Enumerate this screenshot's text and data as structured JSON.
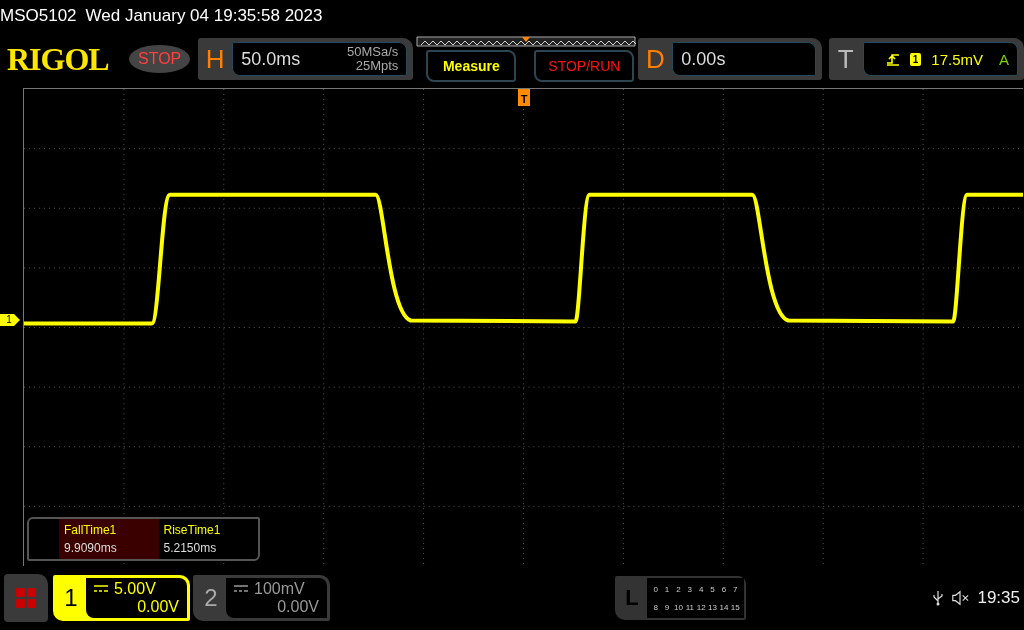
{
  "status_line": {
    "model": "MSO5102",
    "datetime": "Wed January 04 19:35:58 2023"
  },
  "brand": "RIGOL",
  "run_state": "STOP",
  "horizontal": {
    "label": "H",
    "timebase": "50.0ms",
    "sample_rate": "50MSa/s",
    "memory_depth": "25Mpts"
  },
  "buttons": [
    {
      "label": "Measure",
      "color": "#ffff00"
    },
    {
      "label": "STOP/RUN",
      "color": "#ff1010"
    }
  ],
  "delay": {
    "label": "D",
    "value": "0.00s"
  },
  "trigger": {
    "label": "T",
    "channel": "1",
    "level": "17.5mV",
    "mode": "A"
  },
  "markers": {
    "channel": "1",
    "trigger": "T"
  },
  "measurements": [
    {
      "name": "FallTime1",
      "value": "9.9090ms",
      "selected": true
    },
    {
      "name": "RiseTime1",
      "value": "5.2150ms",
      "selected": false
    }
  ],
  "channels": [
    {
      "number": "1",
      "scale": "5.00V",
      "offset": "0.00V",
      "selected": true
    },
    {
      "number": "2",
      "scale": "100mV",
      "offset": "0.00V",
      "selected": false
    }
  ],
  "logic": {
    "label": "L",
    "rows": [
      [
        "0",
        "1",
        "2",
        "3",
        "4",
        "5",
        "6",
        "7"
      ],
      [
        "8",
        "9",
        "10",
        "11",
        "12",
        "13",
        "14",
        "15"
      ]
    ]
  },
  "clock": "19:35"
}
